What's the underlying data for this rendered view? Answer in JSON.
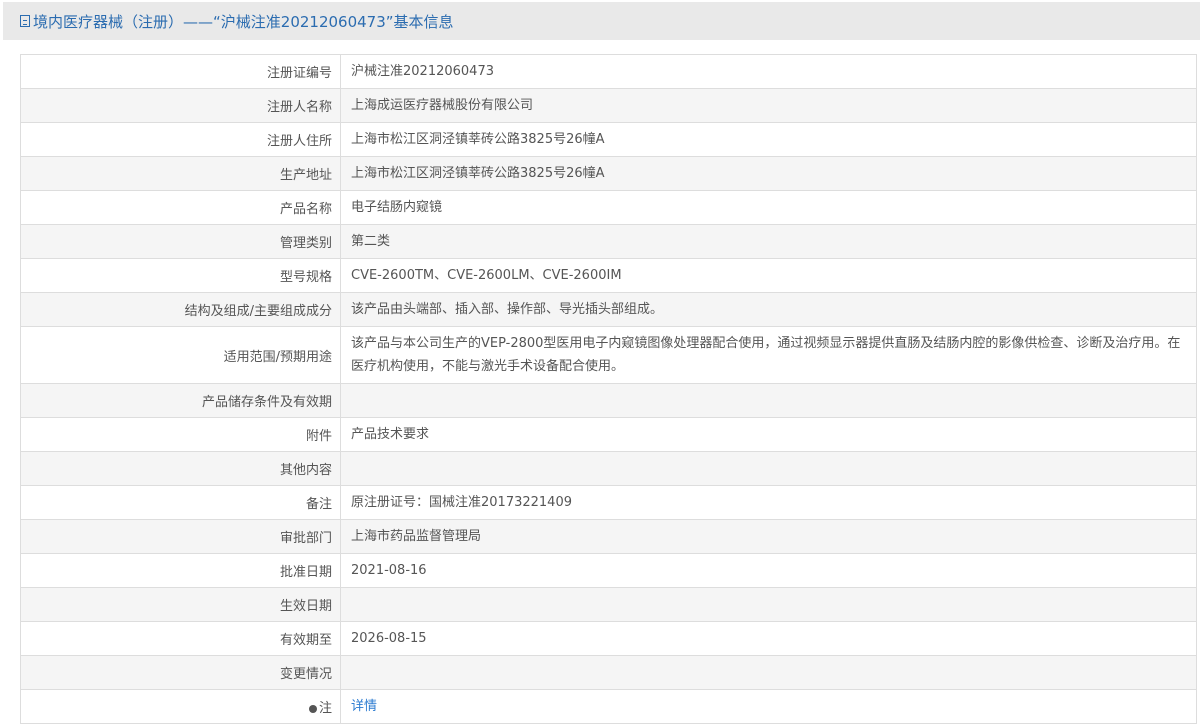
{
  "header": {
    "title": "境内医疗器械（注册）——“沪械注准20212060473”基本信息"
  },
  "rows": [
    {
      "label": "注册证编号",
      "value": "沪械注准20212060473"
    },
    {
      "label": "注册人名称",
      "value": "上海成运医疗器械股份有限公司"
    },
    {
      "label": "注册人住所",
      "value": "上海市松江区洞泾镇莘砖公路3825号26幢A"
    },
    {
      "label": "生产地址",
      "value": "上海市松江区洞泾镇莘砖公路3825号26幢A"
    },
    {
      "label": "产品名称",
      "value": "电子结肠内窥镜"
    },
    {
      "label": "管理类别",
      "value": "第二类"
    },
    {
      "label": "型号规格",
      "value": "CVE-2600TM、CVE-2600LM、CVE-2600IM"
    },
    {
      "label": "结构及组成/主要组成成分",
      "value": "该产品由头端部、插入部、操作部、导光插头部组成。"
    },
    {
      "label": "适用范围/预期用途",
      "value": "该产品与本公司生产的VEP-2800型医用电子内窥镜图像处理器配合使用，通过视频显示器提供直肠及结肠内腔的影像供检查、诊断及治疗用。在医疗机构使用，不能与激光手术设备配合使用。"
    },
    {
      "label": "产品储存条件及有效期",
      "value": ""
    },
    {
      "label": "附件",
      "value": "产品技术要求"
    },
    {
      "label": "其他内容",
      "value": ""
    },
    {
      "label": "备注",
      "value": "原注册证号：国械注准20173221409"
    },
    {
      "label": "审批部门",
      "value": "上海市药品监督管理局"
    },
    {
      "label": "批准日期",
      "value": "2021-08-16"
    },
    {
      "label": "生效日期",
      "value": ""
    },
    {
      "label": "有效期至",
      "value": "2026-08-15"
    },
    {
      "label": "变更情况",
      "value": ""
    }
  ],
  "note": {
    "label": "注",
    "link": "详情"
  }
}
